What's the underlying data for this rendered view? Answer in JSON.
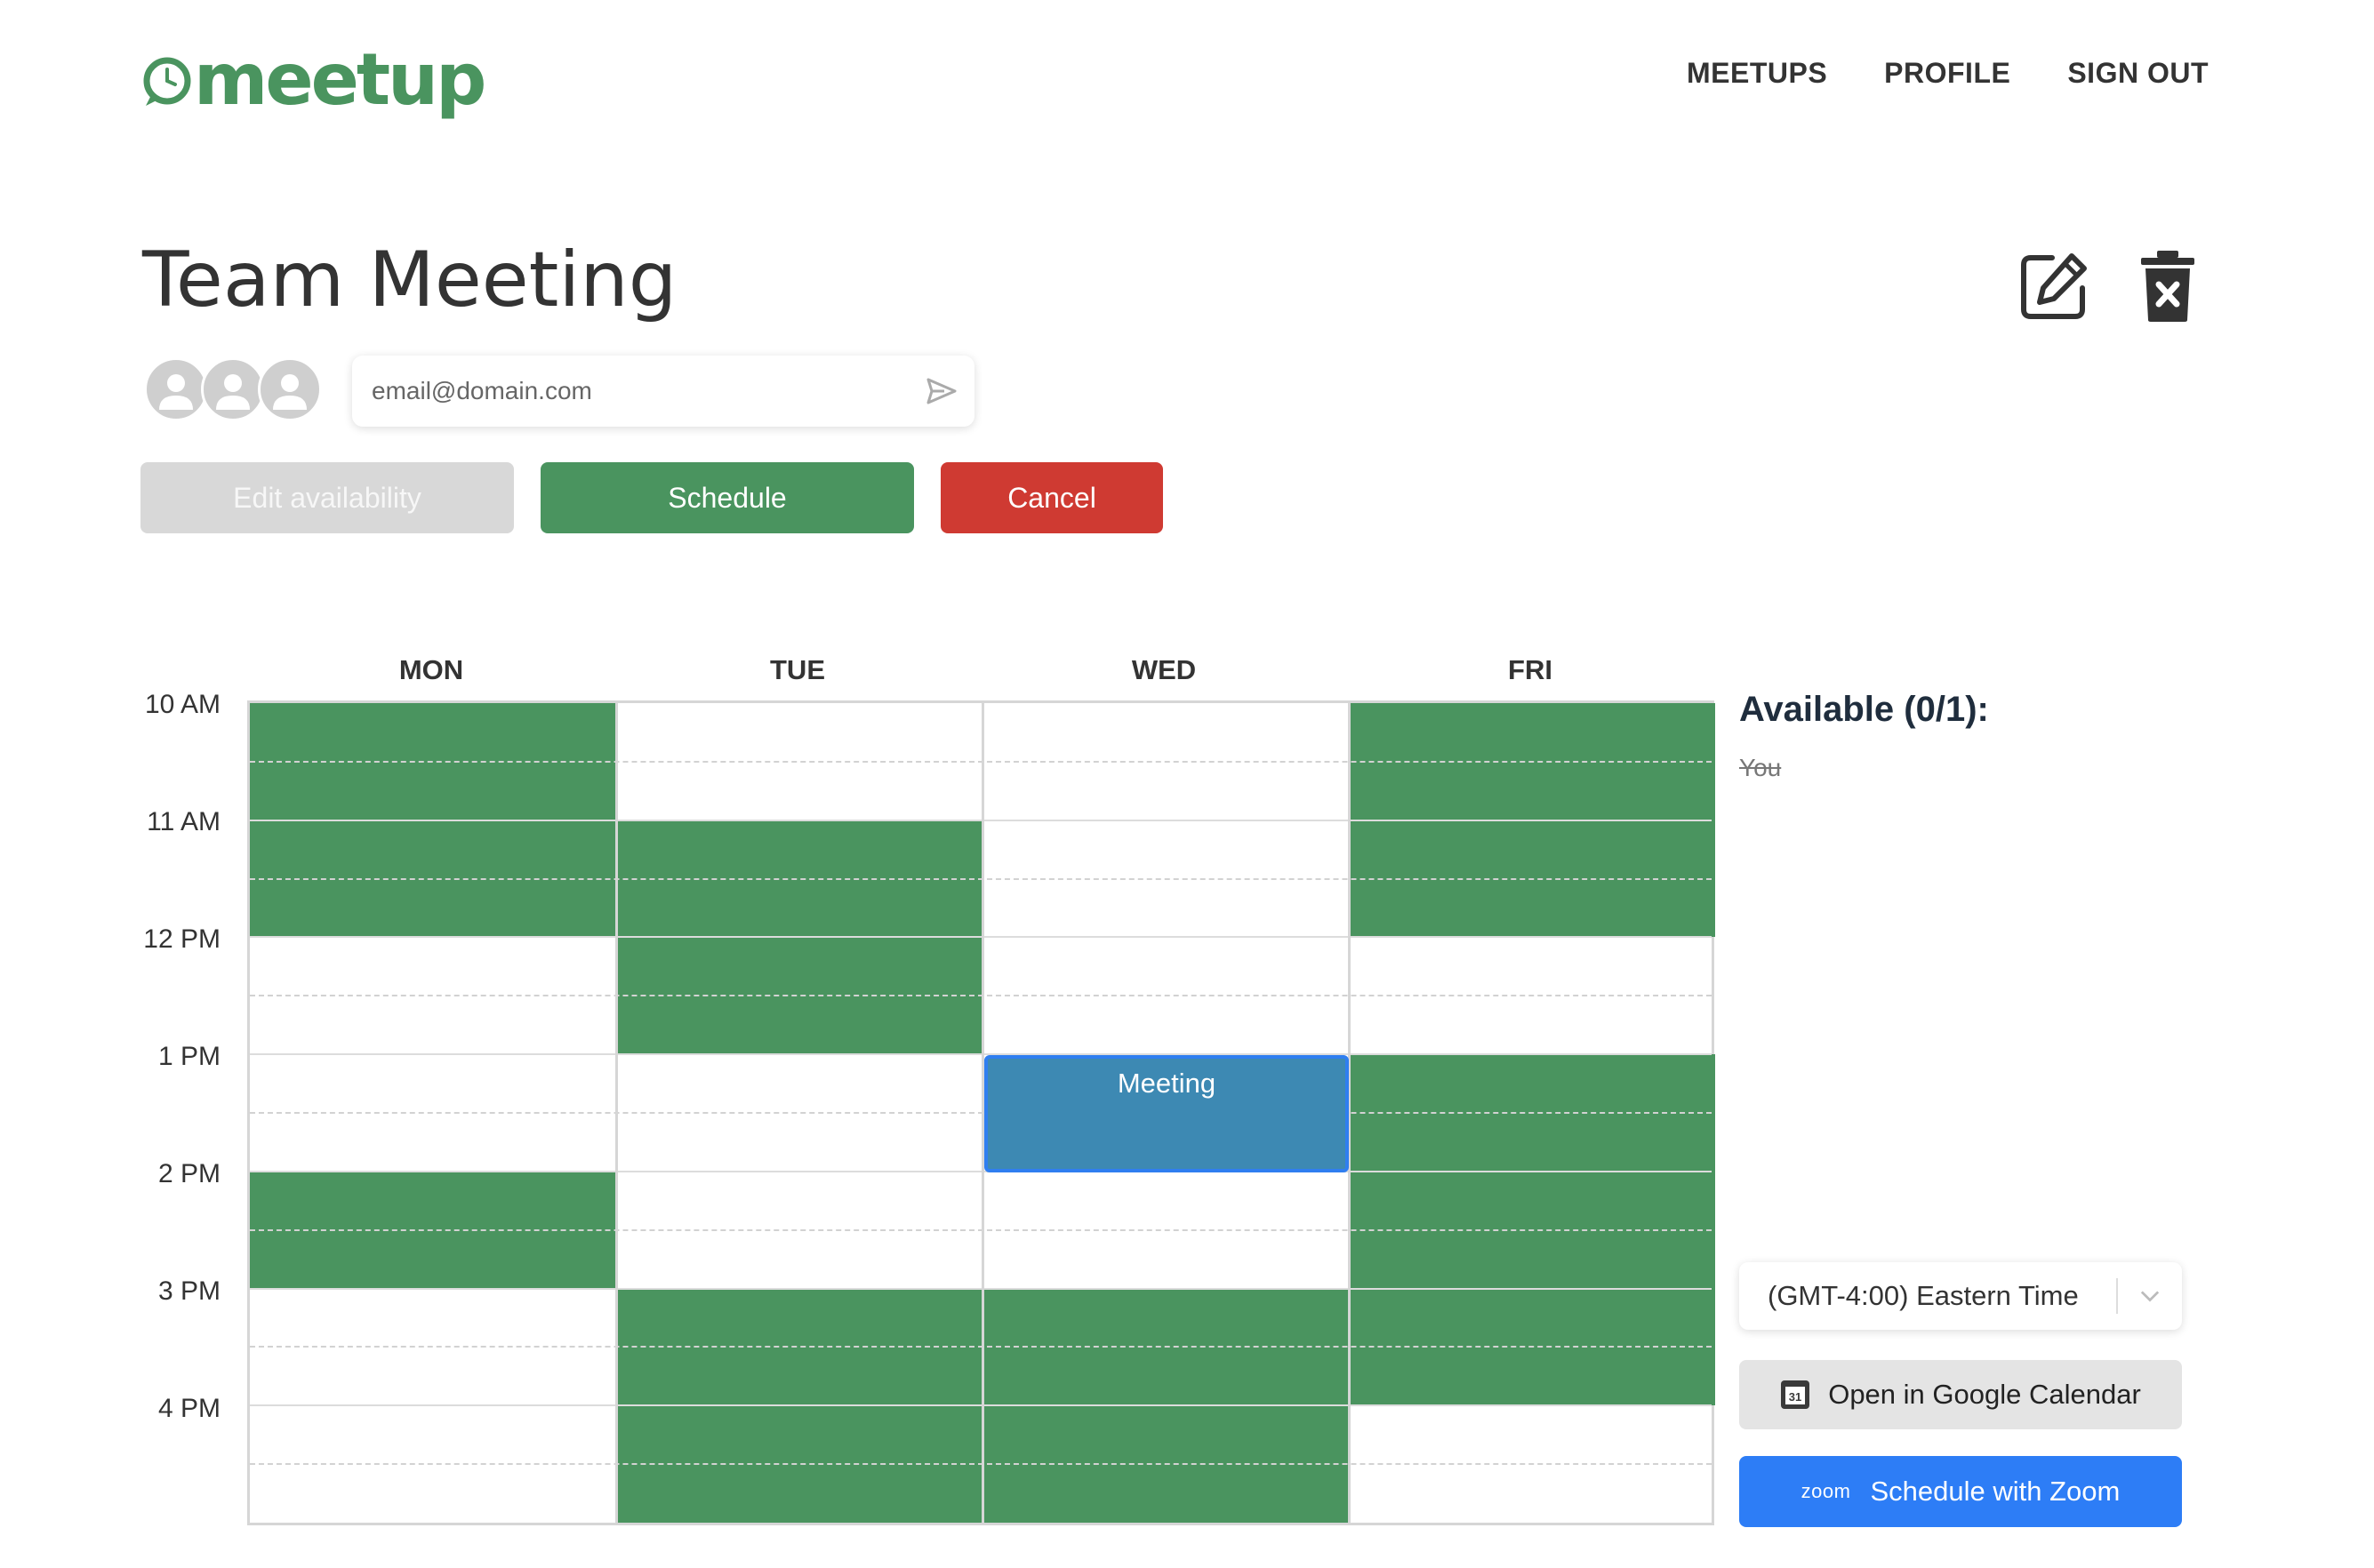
{
  "brand": {
    "logo_text": "meetup",
    "color": "#4a945f"
  },
  "nav": {
    "items": [
      "MEETUPS",
      "PROFILE",
      "SIGN OUT"
    ]
  },
  "meeting": {
    "title": "Team Meeting"
  },
  "invite": {
    "placeholder": "email@domain.com",
    "value": ""
  },
  "actions": {
    "edit_availability": "Edit availability",
    "schedule": "Schedule",
    "cancel": "Cancel"
  },
  "calendar": {
    "days": [
      "MON",
      "TUE",
      "WED",
      "FRI"
    ],
    "times": [
      "10 AM",
      "11 AM",
      "12 PM",
      "1 PM",
      "2 PM",
      "3 PM",
      "4 PM"
    ],
    "availability_color": "#4a945f",
    "availability": [
      {
        "day": "MON",
        "start": "10:00",
        "end": "12:00"
      },
      {
        "day": "MON",
        "start": "14:00",
        "end": "15:00"
      },
      {
        "day": "TUE",
        "start": "11:00",
        "end": "13:00"
      },
      {
        "day": "TUE",
        "start": "15:00",
        "end": "17:00"
      },
      {
        "day": "WED",
        "start": "15:00",
        "end": "17:00"
      },
      {
        "day": "FRI",
        "start": "10:00",
        "end": "12:00"
      },
      {
        "day": "FRI",
        "start": "13:00",
        "end": "16:00"
      }
    ],
    "meeting_event": {
      "label": "Meeting",
      "day": "WED",
      "start": "13:00",
      "end": "14:00",
      "color": "#3d89b3"
    }
  },
  "sidebar": {
    "available_title": "Available (0/1):",
    "available_people": [
      "You"
    ],
    "timezone": "(GMT-4:00) Eastern Time",
    "google_calendar": "Open in Google Calendar",
    "gcal_icon_text": "31",
    "zoom_wordmark": "zoom",
    "zoom": "Schedule with Zoom"
  }
}
